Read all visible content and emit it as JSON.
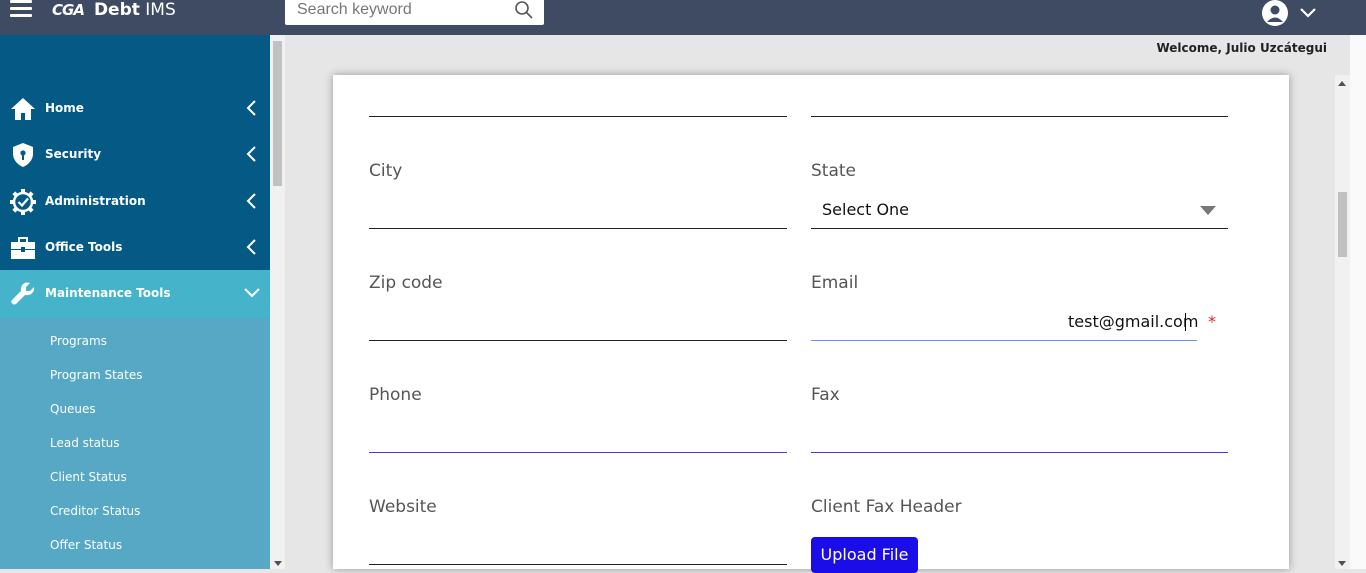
{
  "app": {
    "logo_mark": "CGA",
    "name_bold": "Debt",
    "name_rest": " IMS"
  },
  "search": {
    "placeholder": "Search keyword"
  },
  "header": {
    "welcome": "Welcome, Julio Uzcátegui"
  },
  "sidebar": {
    "items": [
      {
        "label": "Home",
        "icon": "home-icon"
      },
      {
        "label": "Security",
        "icon": "shield-icon"
      },
      {
        "label": "Administration",
        "icon": "gear-check-icon"
      },
      {
        "label": "Office Tools",
        "icon": "toolbox-icon"
      },
      {
        "label": "Maintenance Tools",
        "icon": "wrench-icon",
        "expanded": true
      }
    ],
    "subitems": [
      "Programs",
      "Program States",
      "Queues",
      "Lead status",
      "Client Status",
      "Creditor Status",
      "Offer Status"
    ]
  },
  "form": {
    "city_label": "City",
    "state_label": "State",
    "state_value": "Select One",
    "zip_label": "Zip code",
    "email_label": "Email",
    "email_value": "test@gmail.com",
    "email_required_mark": "*",
    "phone_label": "Phone",
    "fax_label": "Fax",
    "website_label": "Website",
    "fax_header_label": "Client Fax Header",
    "upload_label": "Upload File"
  },
  "colors": {
    "topbar": "#3e4b62",
    "sidebar": "#055a85",
    "sidebar_active": "#45b3c9",
    "submenu": "#56a8c5",
    "upload_button": "#1a0de8",
    "focus_line": "#5c2fd8",
    "required": "#e02424"
  }
}
